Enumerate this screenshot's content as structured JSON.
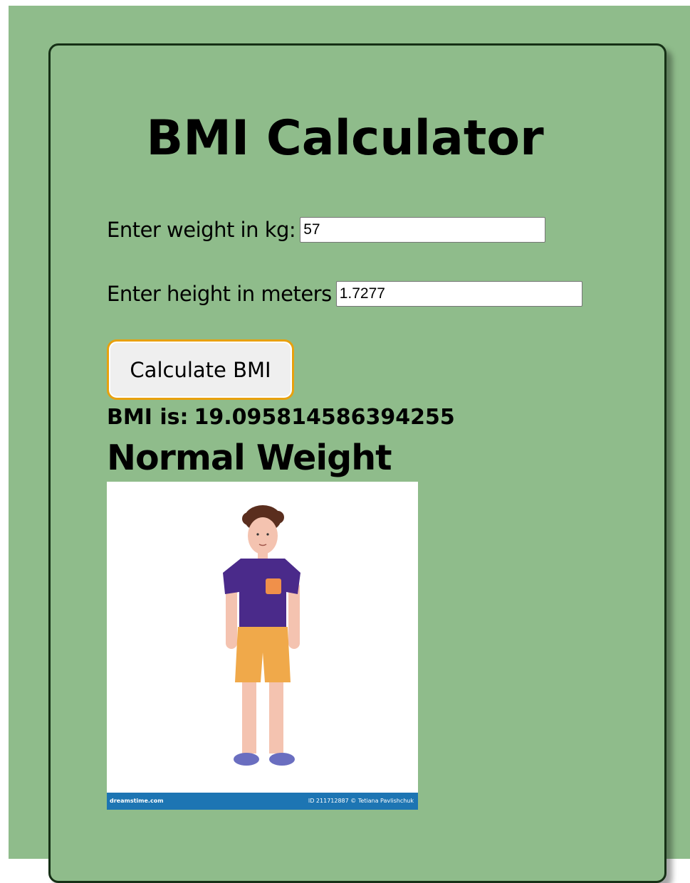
{
  "app": {
    "title": "BMI Calculator"
  },
  "form": {
    "weight_label": "Enter weight in kg:",
    "weight_value": "57",
    "height_label": "Enter height in meters",
    "height_value": "1.7277",
    "calculate_button_label": "Calculate BMI"
  },
  "result": {
    "bmi_label": "BMI is:",
    "bmi_value": "19.095814586394255",
    "category": "Normal Weight"
  },
  "illustration": {
    "watermark_left": "dreamstime.com",
    "watermark_right": "ID 211712887 © Tetiana Pavlishchuk"
  },
  "colors": {
    "background": "#8fbc8b",
    "card_border": "#163016",
    "button_focus_border": "#e8a10e",
    "shirt": "#4a2a8a",
    "shorts": "#f0a94a",
    "shoes": "#6a6ec0",
    "skin": "#f4c3b0",
    "hair": "#5a2e1e",
    "watermark_bar": "#1d75b3"
  }
}
